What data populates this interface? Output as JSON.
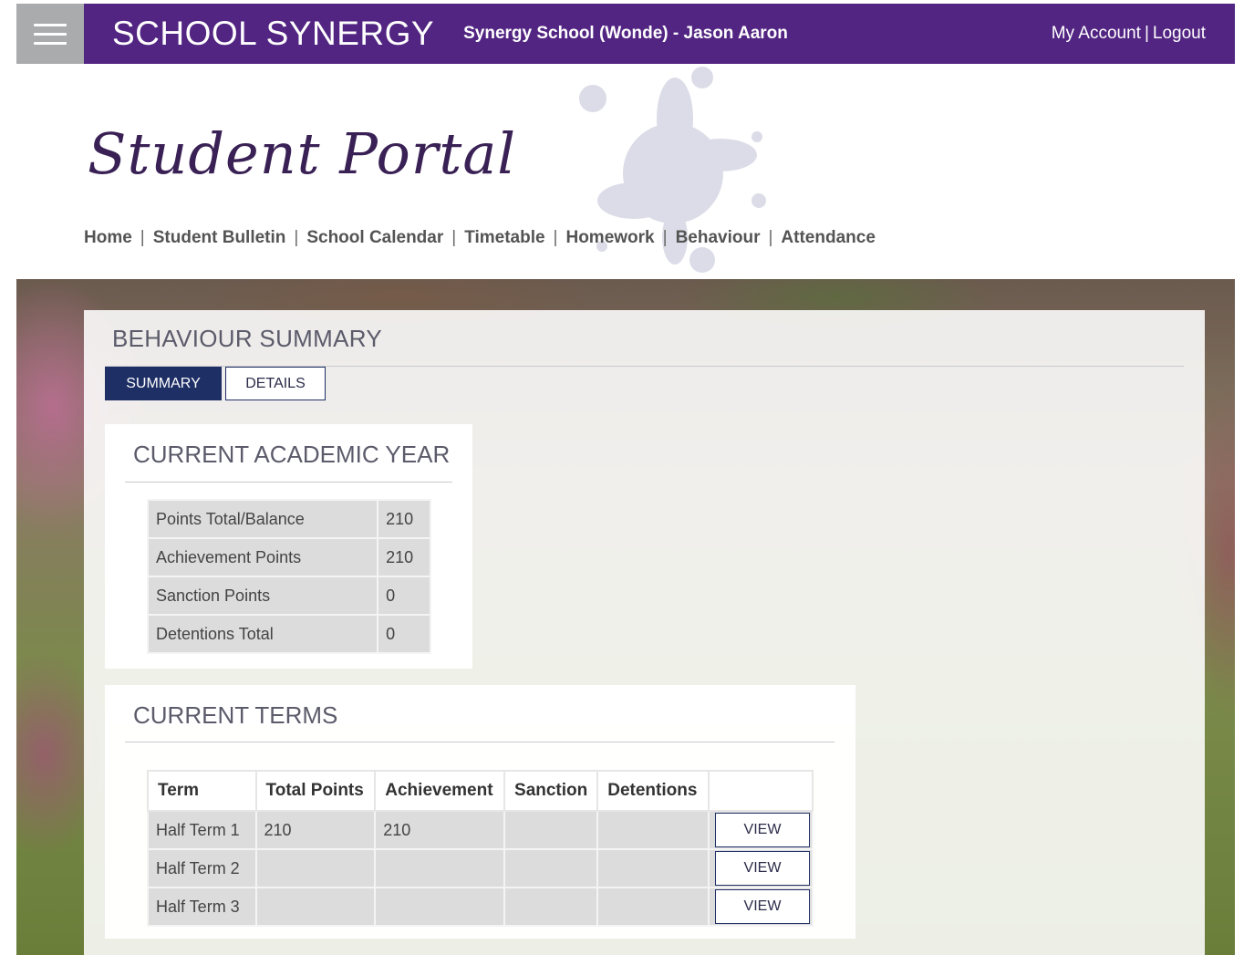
{
  "topbar": {
    "brand": "SCHOOL SYNERGY",
    "school_user": "Synergy School (Wonde) - Jason Aaron",
    "my_account": "My Account",
    "separator": "|",
    "logout": "Logout"
  },
  "header": {
    "portal_title": "Student Portal"
  },
  "nav": {
    "items": [
      {
        "label": "Home"
      },
      {
        "label": "Student Bulletin"
      },
      {
        "label": "School Calendar"
      },
      {
        "label": "Timetable"
      },
      {
        "label": "Homework"
      },
      {
        "label": "Behaviour"
      },
      {
        "label": "Attendance"
      }
    ],
    "separator": "|"
  },
  "behaviour": {
    "title": "BEHAVIOUR SUMMARY",
    "tabs": {
      "summary": "SUMMARY",
      "details": "DETAILS"
    },
    "current_year": {
      "title": "CURRENT ACADEMIC YEAR",
      "rows": [
        {
          "label": "Points Total/Balance",
          "value": "210"
        },
        {
          "label": "Achievement Points",
          "value": "210"
        },
        {
          "label": "Sanction Points",
          "value": "0"
        },
        {
          "label": "Detentions Total",
          "value": "0"
        }
      ]
    },
    "current_terms": {
      "title": "CURRENT TERMS",
      "headers": {
        "term": "Term",
        "total_points": "Total Points",
        "achievement": "Achievement",
        "sanction": "Sanction",
        "detentions": "Detentions"
      },
      "view_label": "VIEW",
      "rows": [
        {
          "term": "Half Term 1",
          "total_points": "210",
          "achievement": "210",
          "sanction": "",
          "detentions": ""
        },
        {
          "term": "Half Term 2",
          "total_points": "",
          "achievement": "",
          "sanction": "",
          "detentions": ""
        },
        {
          "term": "Half Term 3",
          "total_points": "",
          "achievement": "",
          "sanction": "",
          "detentions": ""
        }
      ]
    }
  },
  "colors": {
    "topbar": "#522582",
    "menu_button": "#a9abad",
    "active_tab": "#1e2f66",
    "table_cell": "#dcdcdc"
  }
}
